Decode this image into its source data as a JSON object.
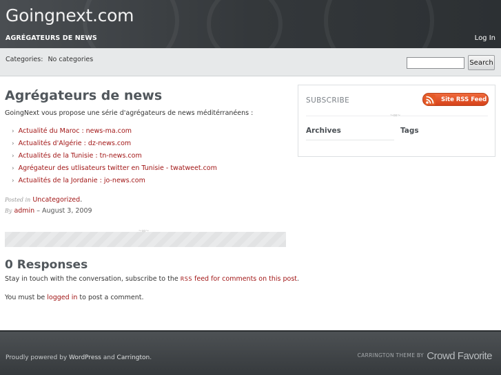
{
  "header": {
    "site_title": "Goingnext.com",
    "tagline": "AGRÉGATEURS DE NEWS",
    "login_label": "Log In"
  },
  "subbar": {
    "categories_label": "Categories:",
    "categories_value": "No categories",
    "search_placeholder": "",
    "search_button": "Search"
  },
  "post": {
    "title": "Agrégateurs de news",
    "intro": "GoingNext vous propose une série d'agrégateurs de news méditérranéens :",
    "links": [
      {
        "label": "Actualité du Maroc : news-ma.com"
      },
      {
        "label": "Actualités d'Algérie : dz-news.com"
      },
      {
        "label": "Actualités de la Tunisie : tn-news.com"
      },
      {
        "label": "Agrégateur des utlisateurs twitter en Tunisie - twatweet.com"
      },
      {
        "label": "Actualités de la Jordanie : jo-news.com"
      }
    ],
    "posted_in_label": "Posted in",
    "category": "Uncategorized",
    "period": ".",
    "by_label": "By",
    "author": "admin",
    "date_sep": "–",
    "date": "August 3, 2009"
  },
  "comments": {
    "title": "0 Responses",
    "stay_prefix": "Stay in touch with the conversation, subscribe to the",
    "rss_abbr": "RSS",
    "stay_link": "feed for comments on this post",
    "stay_suffix": ".",
    "must_prefix": "You must be",
    "must_link": "logged in",
    "must_suffix": "to post a comment."
  },
  "sidebar": {
    "subscribe_label": "SUBSCRIBE",
    "rss_button_label": "Site RSS Feed",
    "archives_title": "Archives",
    "tags_title": "Tags"
  },
  "footer": {
    "prefix": "Proudly powered by",
    "wordpress": "WordPress",
    "and": "and",
    "carrington": "Carrington",
    "period": ".",
    "credit_small": "CARRINGTON THEME BY",
    "credit_brand": "Crowd Favorite"
  },
  "colors": {
    "link_red": "#a11515",
    "header_bg": "#3a3e41",
    "rss_orange": "#e05a2a"
  }
}
